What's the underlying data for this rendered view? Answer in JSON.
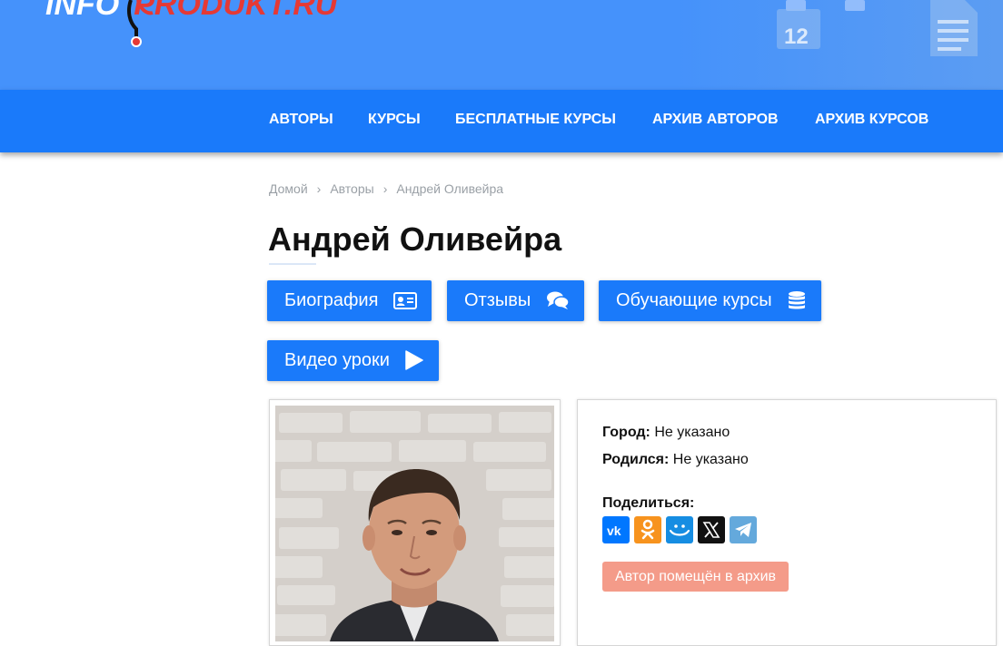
{
  "header": {
    "logo_part1": "iNFO",
    "logo_part2": "PRODUKT.RU",
    "calendar_number": "12"
  },
  "nav": {
    "items": [
      {
        "label": "АВТОРЫ"
      },
      {
        "label": "КУРСЫ"
      },
      {
        "label": "БЕСПЛАТНЫЕ КУРСЫ"
      },
      {
        "label": "АРХИВ АВТОРОВ"
      },
      {
        "label": "АРХИВ КУРСОВ"
      }
    ]
  },
  "breadcrumb": {
    "home": "Домой",
    "section": "Авторы",
    "current": "Андрей Оливейра",
    "separator": "›"
  },
  "page": {
    "title": "Андрей Оливейра"
  },
  "tabs": [
    {
      "label": "Биография",
      "icon": "id-card-icon"
    },
    {
      "label": "Отзывы",
      "icon": "comments-icon"
    },
    {
      "label": "Обучающие курсы",
      "icon": "database-icon"
    },
    {
      "label": "Видео уроки",
      "icon": "play-icon"
    }
  ],
  "info": {
    "city_label": "Город:",
    "city_value": " Не указано",
    "born_label": "Родился:",
    "born_value": " Не указано",
    "share_label": "Поделиться:",
    "archive_badge": "Автор помещён в архив"
  },
  "social": [
    {
      "name": "vk-icon",
      "color": "#0077ff"
    },
    {
      "name": "odnoklassniki-icon",
      "color": "#f7931e"
    },
    {
      "name": "moimir-icon",
      "color": "#168de2"
    },
    {
      "name": "x-twitter-icon",
      "color": "#111111"
    },
    {
      "name": "telegram-icon",
      "color": "#64a9dc"
    }
  ],
  "colors": {
    "header": "#4592fb",
    "navbar": "#1a7afa",
    "button": "#1a7afa",
    "archive": "#f49b89"
  }
}
